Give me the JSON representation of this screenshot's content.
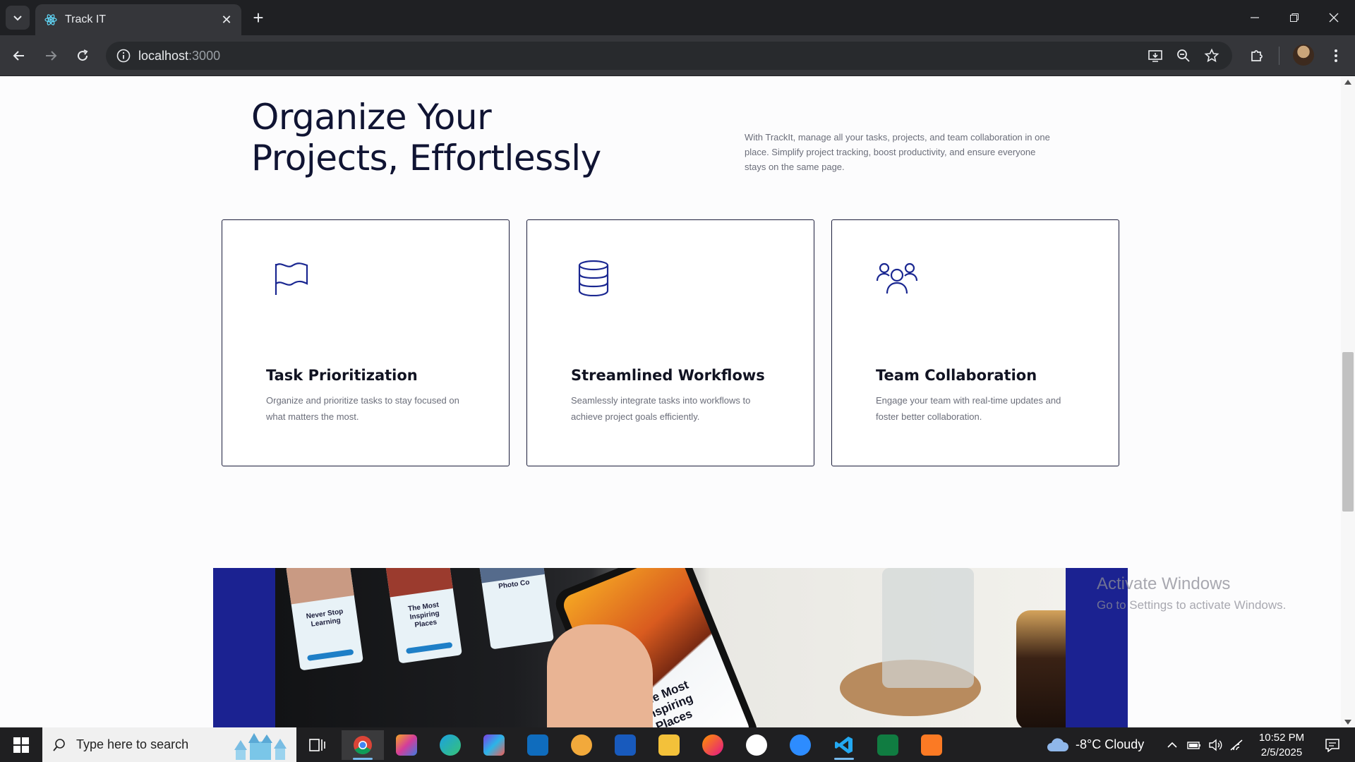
{
  "browser": {
    "tab_title": "Track IT",
    "url_host": "localhost",
    "url_port": ":3000"
  },
  "hero": {
    "title_line1": "Organize Your",
    "title_line2": "Projects, Effortlessly",
    "description": "With TrackIt, manage all your tasks, projects, and team collaboration in one place. Simplify project tracking, boost productivity, and ensure everyone stays on the same page."
  },
  "features": [
    {
      "icon": "flag-icon",
      "title": "Task Prioritization",
      "description": "Organize and prioritize tasks to stay focused on what matters the most."
    },
    {
      "icon": "database-icon",
      "title": "Streamlined Workflows",
      "description": "Seamlessly integrate tasks into workflows to achieve project goals efficiently."
    },
    {
      "icon": "team-icon",
      "title": "Team Collaboration",
      "description": "Engage your team with real-time updates and foster better collaboration."
    }
  ],
  "banner": {
    "card1": "Never Stop Learning",
    "card2": "The Most Inspiring Places",
    "card3": "Photo Co",
    "phone_text": "The Most Inspiring Places"
  },
  "watermark": {
    "line1": "Activate Windows",
    "line2": "Go to Settings to activate Windows."
  },
  "taskbar": {
    "search_placeholder": "Type here to search",
    "weather": "-8°C  Cloudy",
    "time": "10:52 PM",
    "date": "2/5/2025"
  },
  "colors": {
    "accent": "#1b2291",
    "icon": "#1a2791",
    "heading": "#101433"
  }
}
